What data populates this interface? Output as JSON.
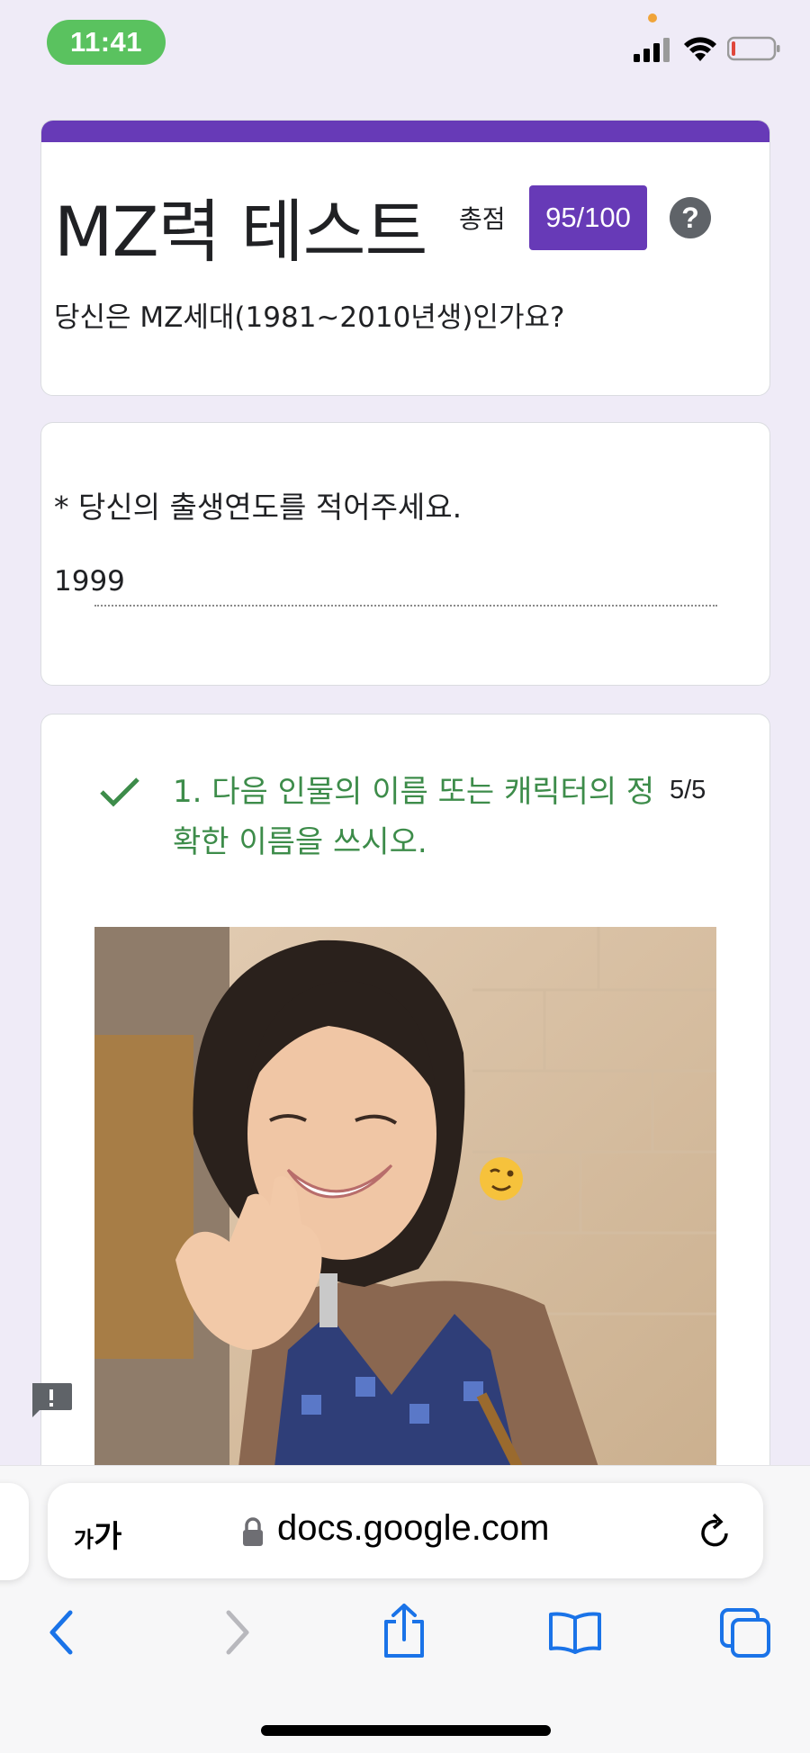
{
  "status_bar": {
    "time": "11:41",
    "icons": [
      "signal-icon",
      "wifi-icon",
      "battery-icon"
    ]
  },
  "form": {
    "title": "MZ력 테스트",
    "score_label": "총점",
    "score": "95/100",
    "help": "?",
    "description": "당신은 MZ세대(1981~2010년생)인가요?",
    "accent_color": "#673ab7"
  },
  "birth_question": {
    "label": "* 당신의 출생연도를 적어주세요.",
    "answer": "1999"
  },
  "question1": {
    "text": "1. 다음 인물의 이름 또는 캐릭터의 정확한 이름을 쓰시오.",
    "points": "5/5",
    "status_icon": "check-icon",
    "correct_color": "#3d8c4a"
  },
  "browser": {
    "text_size_label_small": "가",
    "text_size_label_large": "가",
    "url": "docs.google.com",
    "toolbar_icons": [
      "back-icon",
      "forward-icon",
      "share-icon",
      "bookmarks-icon",
      "tabs-icon"
    ]
  }
}
